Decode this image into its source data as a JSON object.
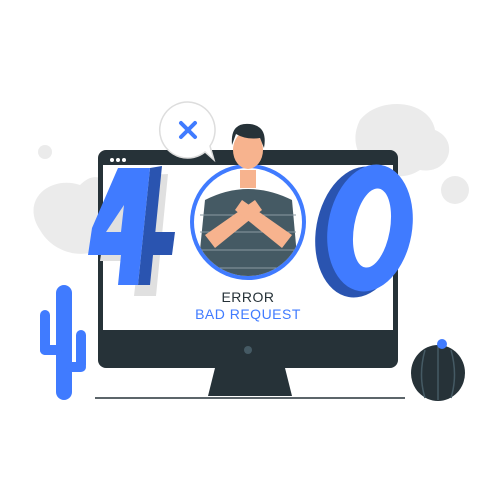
{
  "illustration": {
    "code": "400",
    "error_label": "ERROR",
    "message": "BAD REQUEST",
    "icon": "close-icon"
  },
  "colors": {
    "accent": "#407bff",
    "accent_dark": "#2a54b0",
    "dark": "#263238",
    "blob": "#ebebeb",
    "skin": "#f7b38e"
  }
}
